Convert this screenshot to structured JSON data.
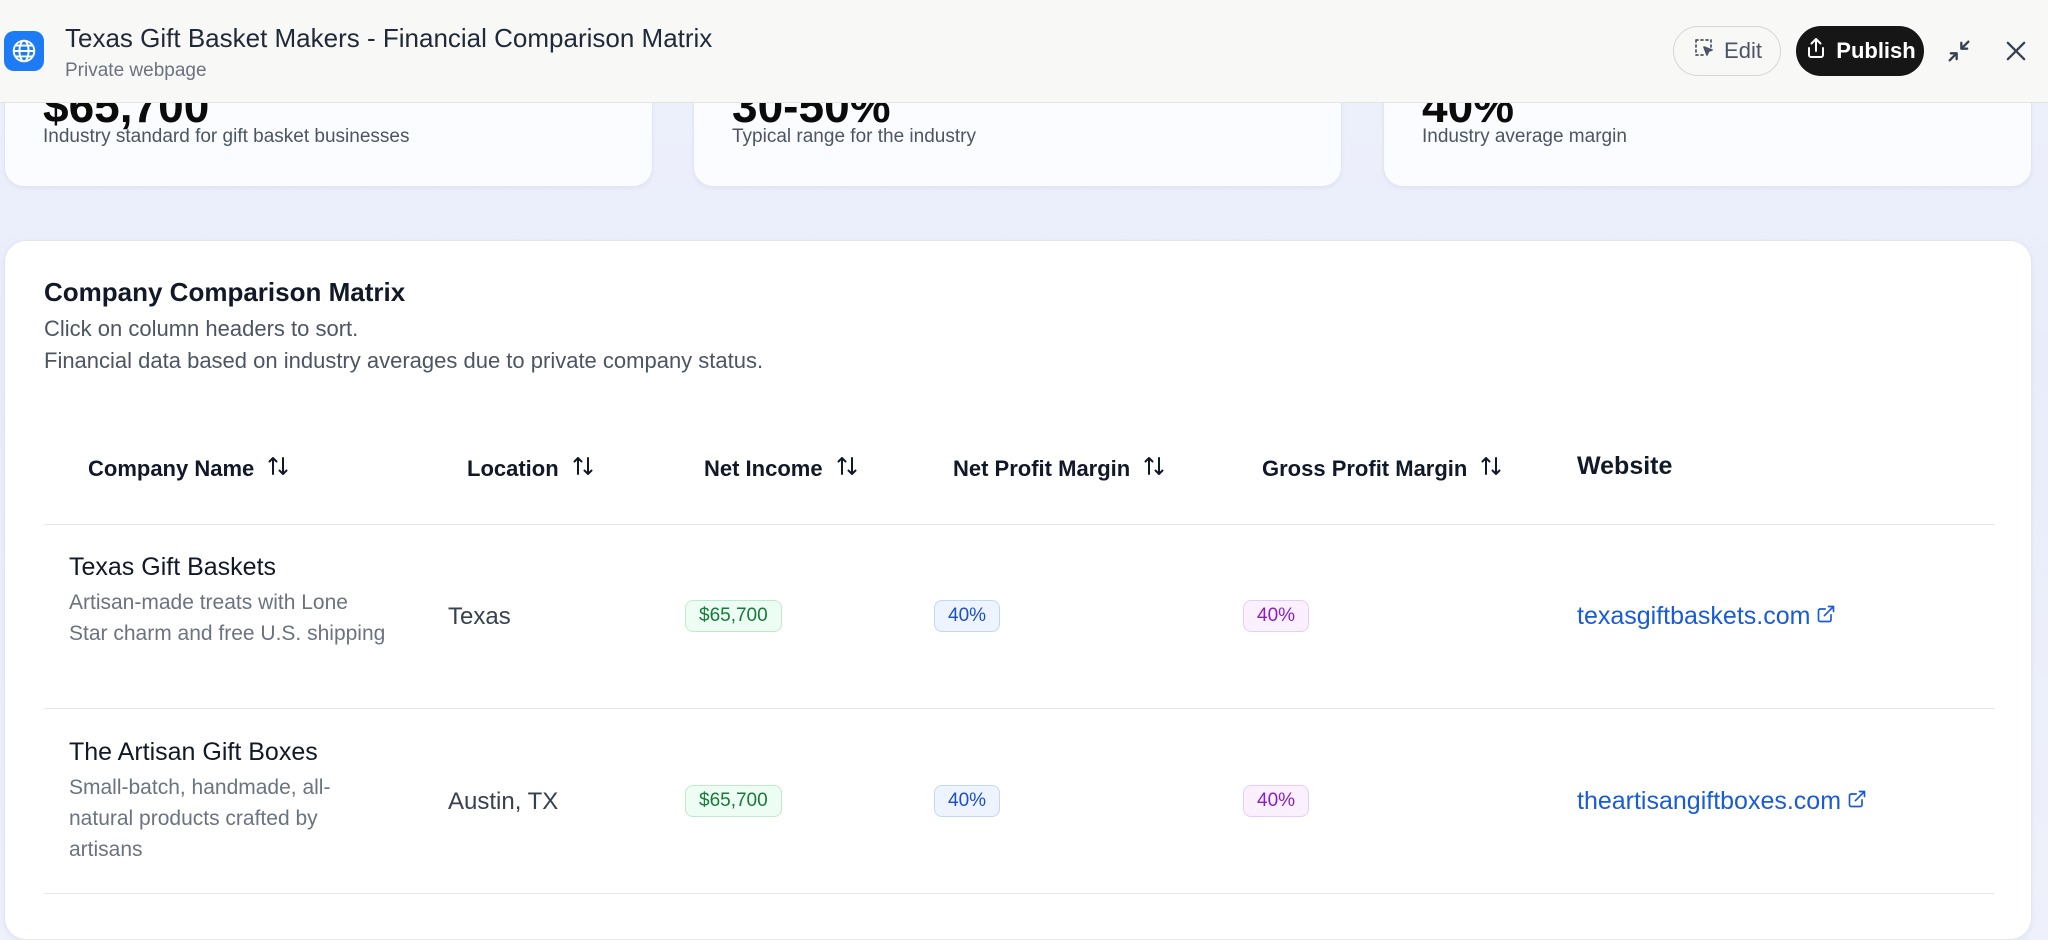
{
  "window": {
    "title": "Texas Gift Basket Makers - Financial Comparison Matrix",
    "subtitle": "Private webpage",
    "edit_label": "Edit",
    "publish_label": "Publish"
  },
  "stats": [
    {
      "value": "$65,700",
      "desc": "Industry standard for gift basket businesses"
    },
    {
      "value": "30-50%",
      "desc": "Typical range for the industry"
    },
    {
      "value": "40%",
      "desc": "Industry average margin"
    }
  ],
  "matrix": {
    "title": "Company Comparison Matrix",
    "line1": "Click on column headers to sort.",
    "line2": "Financial data based on industry averages due to private company status.",
    "headers": {
      "company": "Company Name",
      "location": "Location",
      "net_income": "Net Income",
      "net_margin": "Net Profit Margin",
      "gross_margin": "Gross Profit Margin",
      "website": "Website"
    },
    "rows": [
      {
        "name": "Texas Gift Baskets",
        "desc": "Artisan-made treats with Lone Star charm and free U.S. shipping",
        "location": "Texas",
        "net_income": "$65,700",
        "net_margin": "40%",
        "gross_margin": "40%",
        "website": "texasgiftbaskets.com"
      },
      {
        "name": "The Artisan Gift Boxes",
        "desc": "Small-batch, handmade, all-natural products crafted by artisans",
        "location": "Austin, TX",
        "net_income": "$65,700",
        "net_margin": "40%",
        "gross_margin": "40%",
        "website": "theartisangiftboxes.com"
      }
    ]
  },
  "colors": {
    "accent": "#1d7bf3",
    "link": "#1a5bd6",
    "income_pill": "#167a3a",
    "net_margin_pill": "#1d4fbf",
    "gross_margin_pill": "#8a1fc0"
  }
}
